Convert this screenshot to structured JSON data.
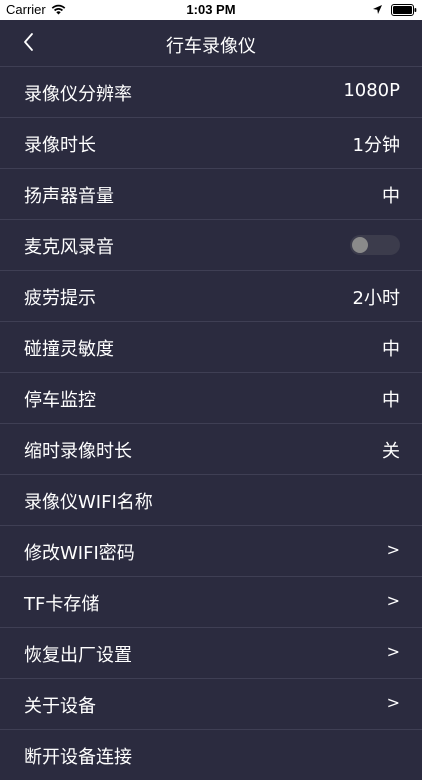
{
  "status_bar": {
    "carrier": "Carrier",
    "time": "1:03 PM"
  },
  "nav": {
    "title": "行车录像仪"
  },
  "settings": [
    {
      "label": "录像仪分辨率",
      "value": "1080P"
    },
    {
      "label": "录像时长",
      "value": "1分钟"
    },
    {
      "label": "扬声器音量",
      "value": "中"
    },
    {
      "label": "麦克风录音",
      "toggle_on": false
    },
    {
      "label": "疲劳提示",
      "value": "2小时"
    },
    {
      "label": "碰撞灵敏度",
      "value": "中"
    },
    {
      "label": "停车监控",
      "value": "中"
    },
    {
      "label": "缩时录像时长",
      "value": "关"
    },
    {
      "label": "录像仪WIFI名称"
    },
    {
      "label": "修改WIFI密码",
      "chevron": ">"
    },
    {
      "label": "TF卡存储",
      "chevron": ">"
    },
    {
      "label": "恢复出厂设置",
      "chevron": ">"
    },
    {
      "label": "关于设备",
      "chevron": ">"
    },
    {
      "label": "断开设备连接"
    }
  ]
}
